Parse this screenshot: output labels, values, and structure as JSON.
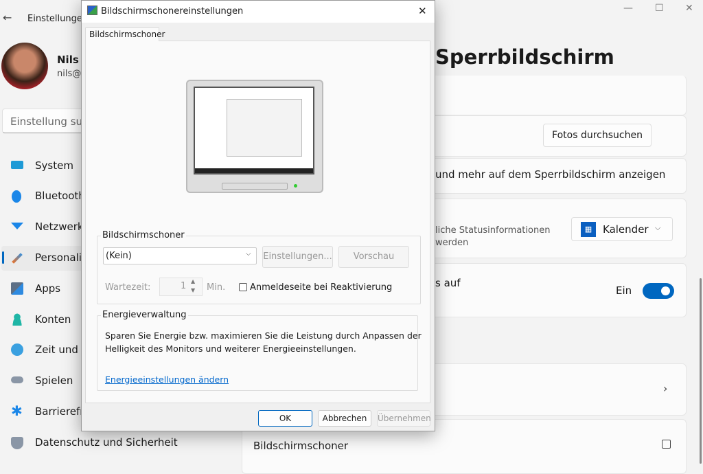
{
  "settings": {
    "app_title": "Einstellungen",
    "user_name": "Nils I",
    "user_email": "nils@",
    "search_placeholder": "Einstellung suc",
    "nav": [
      {
        "label": "System",
        "icon": "monitor-icon"
      },
      {
        "label": "Bluetooth",
        "icon": "bluetooth-icon"
      },
      {
        "label": "Netzwerk",
        "icon": "wifi-icon"
      },
      {
        "label": "Personalis",
        "icon": "brush-icon",
        "selected": true
      },
      {
        "label": "Apps",
        "icon": "apps-icon"
      },
      {
        "label": "Konten",
        "icon": "person-icon"
      },
      {
        "label": "Zeit und S",
        "icon": "clock-icon"
      },
      {
        "label": "Spielen",
        "icon": "gamepad-icon"
      },
      {
        "label": "Barrierefr",
        "icon": "accessibility-icon"
      },
      {
        "label": "Datenschutz und Sicherheit",
        "icon": "shield-icon"
      }
    ],
    "page_title": "Sperrbildschirm",
    "browse_photos": "Fotos durchsuchen",
    "show_more_text": "und mehr auf dem Sperrbildschirm anzeigen",
    "status_text_1": "liche Statusinformationen",
    "status_text_2": "werden",
    "status_app": "Kalender",
    "signin_text": "s auf",
    "toggle_label": "Ein",
    "toggle_on": true,
    "screensaver_link": "Bildschirmschoner",
    "accent": "#0067c0"
  },
  "dialog": {
    "title": "Bildschirmschonereinstellungen",
    "tab": "Bildschirmschoner",
    "group_screensaver": "Bildschirmschoner",
    "screensaver_value": "(Kein)",
    "settings_button": "Einstellungen...",
    "preview_button": "Vorschau",
    "wait_label": "Wartezeit:",
    "wait_value": "1",
    "wait_unit": "Min.",
    "resume_checkbox": "Anmeldeseite bei Reaktivierung",
    "resume_checked": false,
    "group_power": "Energieverwaltung",
    "power_text_1": "Sparen Sie Energie bzw. maximieren Sie die Leistung durch Anpassen der",
    "power_text_2": "Helligkeit des Monitors und weiterer Energieeinstellungen.",
    "power_link": "Energieeinstellungen ändern",
    "ok": "OK",
    "cancel": "Abbrechen",
    "apply": "Übernehmen"
  }
}
